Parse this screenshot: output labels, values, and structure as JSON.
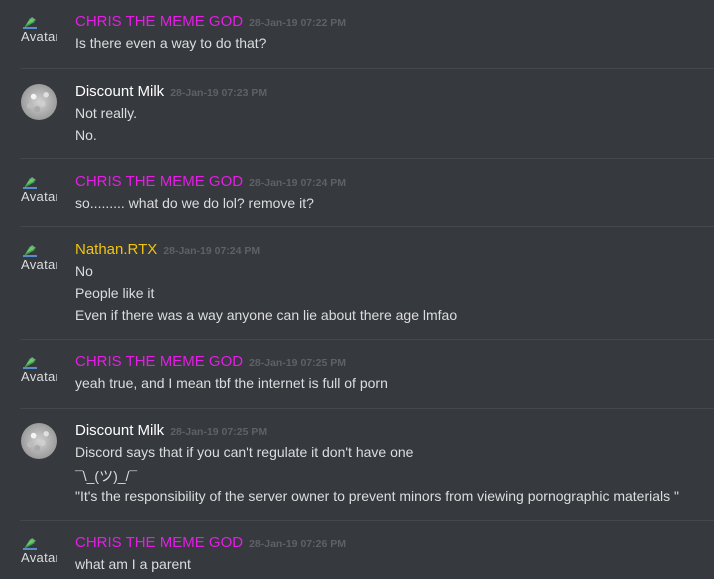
{
  "messages": [
    {
      "author": "CHRIS THE MEME GOD",
      "color": "#e61de6",
      "timestamp": "28-Jan-19 07:22 PM",
      "avatar": "broken",
      "avatar_alt": "Avatar",
      "lines": [
        "Is there even a way to do that?"
      ]
    },
    {
      "author": "Discount Milk",
      "color": "#ffffff",
      "timestamp": "28-Jan-19 07:23 PM",
      "avatar": "image",
      "lines": [
        "Not really.",
        "No."
      ]
    },
    {
      "author": "CHRIS THE MEME GOD",
      "color": "#e61de6",
      "timestamp": "28-Jan-19 07:24 PM",
      "avatar": "broken",
      "avatar_alt": "Avatar",
      "lines": [
        "so......... what do we do lol? remove it?"
      ]
    },
    {
      "author": "Nathan.RTX",
      "color": "#f1c40f",
      "timestamp": "28-Jan-19 07:24 PM",
      "avatar": "broken",
      "avatar_alt": "Avatar",
      "lines": [
        "No",
        "People like it",
        "Even if there was a way anyone can lie about there age lmfao"
      ]
    },
    {
      "author": "CHRIS THE MEME GOD",
      "color": "#e61de6",
      "timestamp": "28-Jan-19 07:25 PM",
      "avatar": "broken",
      "avatar_alt": "Avatar",
      "lines": [
        "yeah true, and I mean tbf the internet is full of porn"
      ]
    },
    {
      "author": "Discount Milk",
      "color": "#ffffff",
      "timestamp": "28-Jan-19 07:25 PM",
      "avatar": "image",
      "lines": [
        "Discord says that if  you can't regulate it don't have one",
        "¯\\_(ツ)_/¯",
        "\"It's the responsibility of the server owner to prevent minors from viewing pornographic materials \""
      ]
    },
    {
      "author": "CHRIS THE MEME GOD",
      "color": "#e61de6",
      "timestamp": "28-Jan-19 07:26 PM",
      "avatar": "broken",
      "avatar_alt": "Avatar",
      "lines": [
        "what am I a parent"
      ]
    }
  ]
}
